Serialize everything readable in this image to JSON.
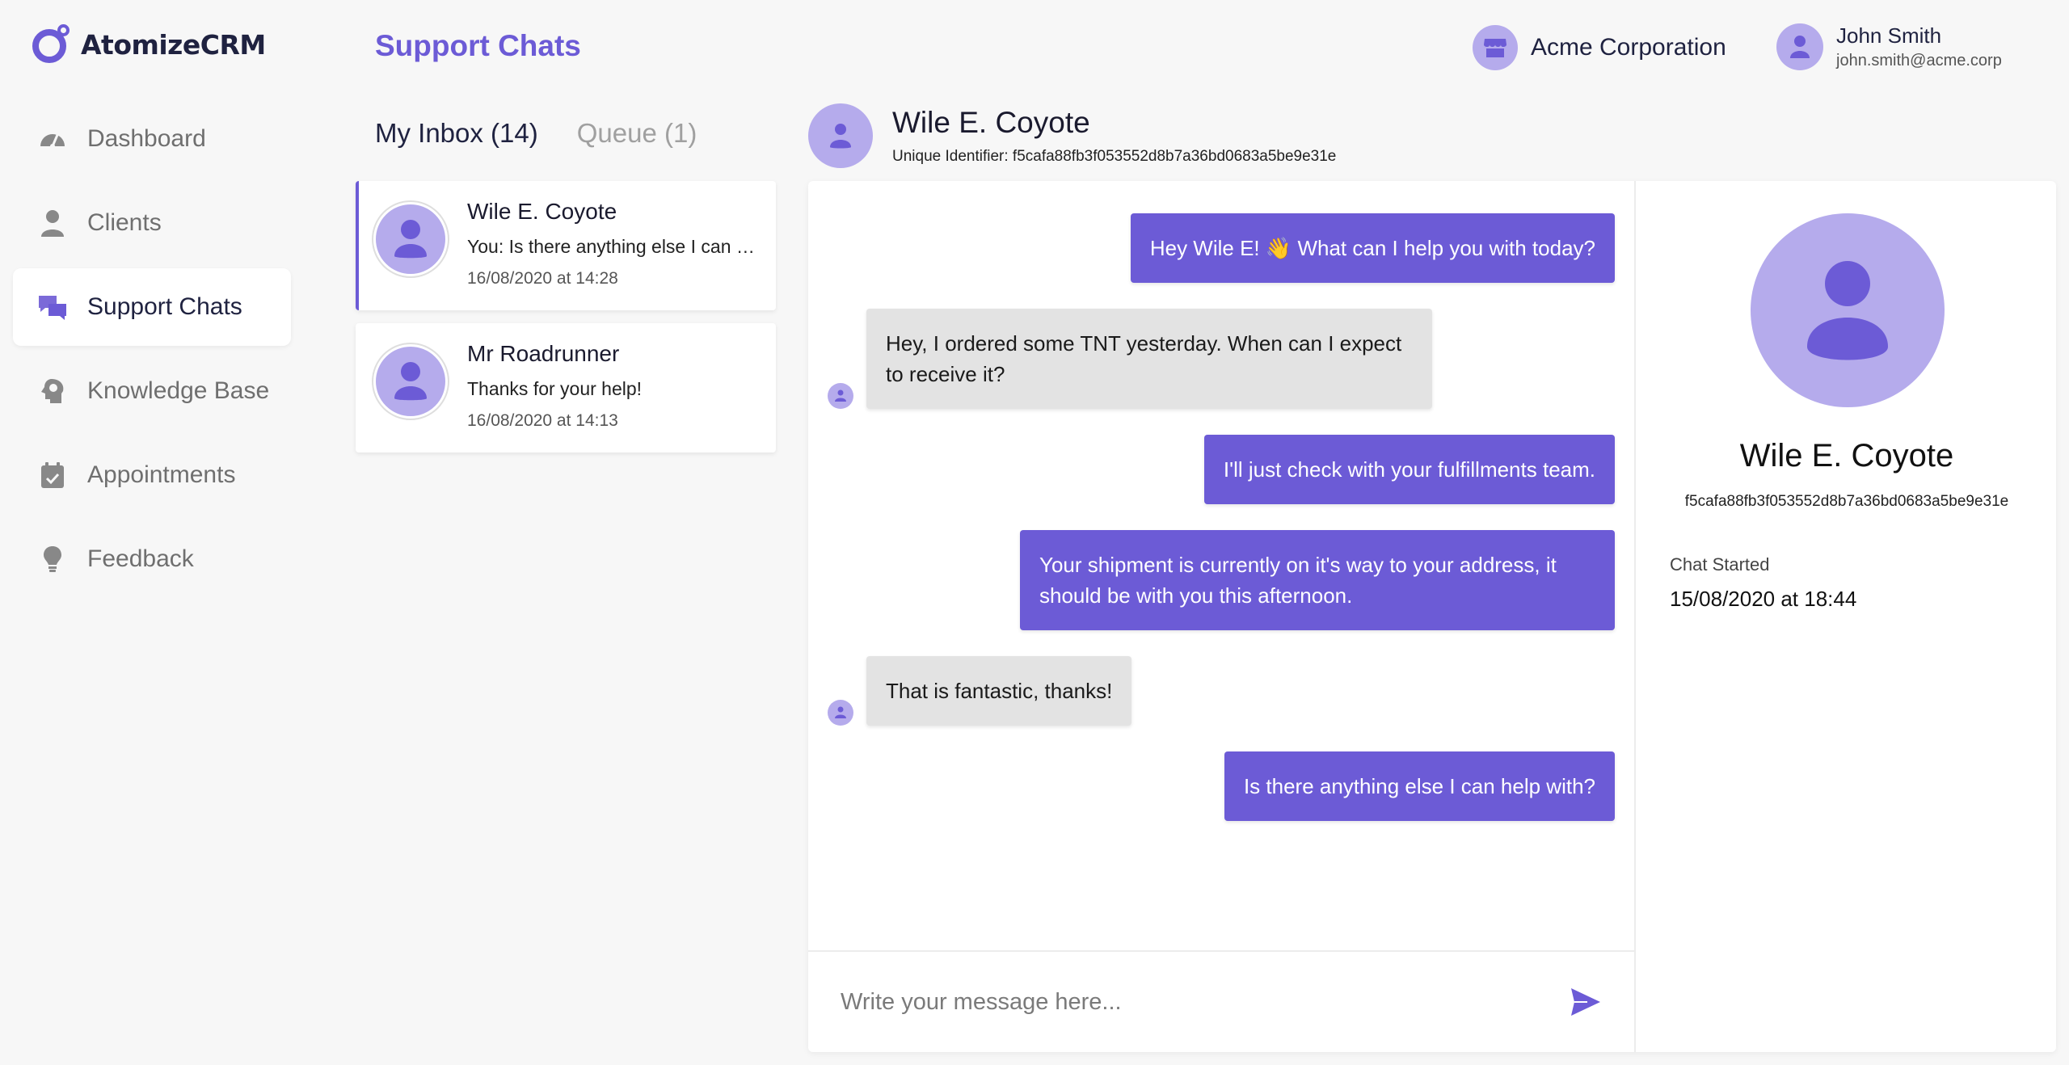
{
  "app": {
    "name": "AtomizeCRM"
  },
  "sidebar": {
    "items": [
      {
        "label": "Dashboard",
        "icon": "gauge-icon"
      },
      {
        "label": "Clients",
        "icon": "person-icon"
      },
      {
        "label": "Support Chats",
        "icon": "chat-bubbles-icon",
        "active": true
      },
      {
        "label": "Knowledge Base",
        "icon": "brain-head-icon"
      },
      {
        "label": "Appointments",
        "icon": "calendar-icon"
      },
      {
        "label": "Feedback",
        "icon": "lightbulb-icon"
      }
    ]
  },
  "header": {
    "title": "Support Chats",
    "organization": "Acme Corporation",
    "user": {
      "name": "John Smith",
      "email": "john.smith@acme.corp"
    }
  },
  "inbox": {
    "tabs": [
      {
        "label": "My Inbox (14)",
        "active": true
      },
      {
        "label": "Queue (1)",
        "active": false
      }
    ],
    "chats": [
      {
        "name": "Wile E. Coyote",
        "preview": "You: Is there anything else I can help with?",
        "time": "16/08/2020 at 14:28",
        "selected": true
      },
      {
        "name": "Mr Roadrunner",
        "preview": "Thanks for your help!",
        "time": "16/08/2020 at 14:13",
        "selected": false
      }
    ]
  },
  "conversation": {
    "name": "Wile E. Coyote",
    "uid_line": "Unique Identifier: f5cafa88fb3f053552d8b7a36bd0683a5be9e31e",
    "messages": [
      {
        "from": "agent",
        "text": "Hey Wile E! 👋 What can I help you with today?"
      },
      {
        "from": "client",
        "text": "Hey, I ordered some TNT yesterday. When can I expect to receive it?"
      },
      {
        "from": "agent",
        "text": "I'll just check with your fulfillments team."
      },
      {
        "from": "agent",
        "text": "Your shipment is currently on it's way to your address, it should be with you this afternoon."
      },
      {
        "from": "client",
        "text": "That is fantastic, thanks!"
      },
      {
        "from": "agent",
        "text": "Is there anything else I can help with?"
      }
    ],
    "composer": {
      "placeholder": "Write your message here..."
    }
  },
  "details": {
    "name": "Wile E. Coyote",
    "uid": "f5cafa88fb3f053552d8b7a36bd0683a5be9e31e",
    "chat_started_label": "Chat Started",
    "chat_started_value": "15/08/2020 at 18:44"
  },
  "colors": {
    "accent": "#6c5bd6",
    "avatar_bg": "#b5abec",
    "client_bubble": "#e3e3e3",
    "background": "#f7f7f7"
  }
}
